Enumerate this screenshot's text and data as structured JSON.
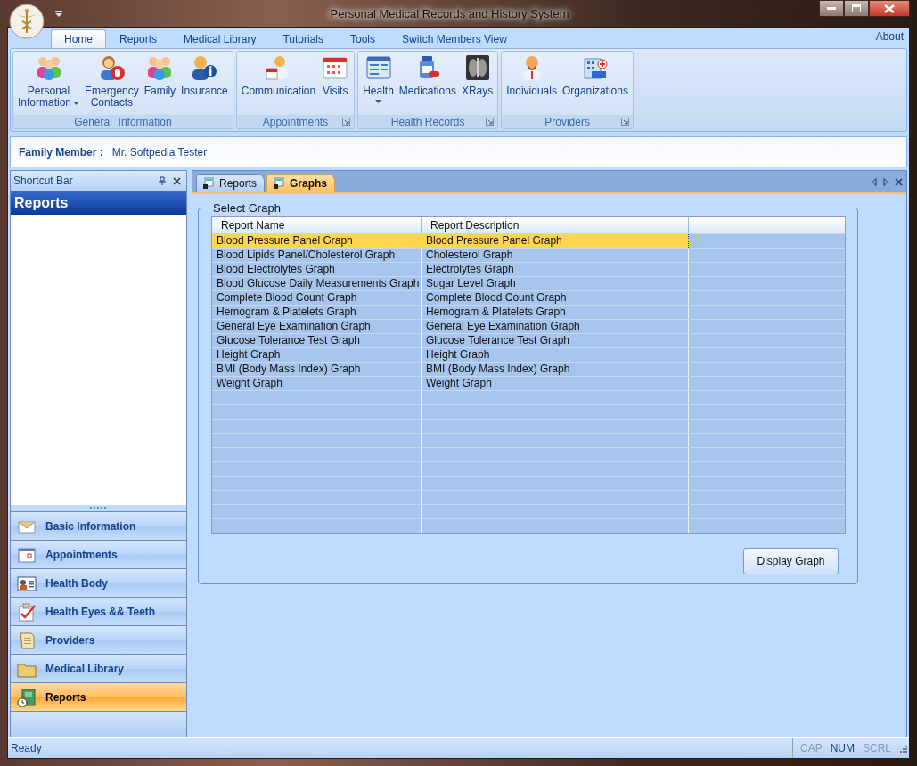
{
  "window": {
    "title": "Personal Medical Records and History System"
  },
  "ribbon": {
    "tabs": [
      {
        "label": "Home",
        "selected": true
      },
      {
        "label": "Reports",
        "selected": false
      },
      {
        "label": "Medical Library",
        "selected": false
      },
      {
        "label": "Tutorials",
        "selected": false
      },
      {
        "label": "Tools",
        "selected": false
      },
      {
        "label": "Switch Members View",
        "selected": false
      }
    ],
    "about": "About",
    "groups": [
      {
        "title": "General  Information",
        "launcher": false,
        "buttons": [
          {
            "lines": [
              "Personal",
              "Information"
            ],
            "dropdown": true
          },
          {
            "lines": [
              "Emergency",
              "Contacts"
            ],
            "dropdown": false
          },
          {
            "lines": [
              "Family"
            ],
            "dropdown": false
          },
          {
            "lines": [
              "Insurance"
            ],
            "dropdown": false
          }
        ]
      },
      {
        "title": "Appointments",
        "launcher": true,
        "buttons": [
          {
            "lines": [
              "Communication"
            ],
            "dropdown": false
          },
          {
            "lines": [
              "Visits"
            ],
            "dropdown": false
          }
        ]
      },
      {
        "title": "Health Records",
        "launcher": true,
        "buttons": [
          {
            "lines": [
              "Health"
            ],
            "dropdown": true
          },
          {
            "lines": [
              "Medications"
            ],
            "dropdown": false
          },
          {
            "lines": [
              "XRays"
            ],
            "dropdown": false
          }
        ]
      },
      {
        "title": "Providers",
        "launcher": true,
        "buttons": [
          {
            "lines": [
              "Individuals"
            ],
            "dropdown": false
          },
          {
            "lines": [
              "Organizations"
            ],
            "dropdown": false
          }
        ]
      }
    ]
  },
  "family_member": {
    "label": "Family Member :",
    "value": "Mr. Softpedia Tester"
  },
  "shortcut_bar": {
    "title": "Shortcut Bar",
    "header": "Reports",
    "items": [
      {
        "label": "Basic Information",
        "selected": false
      },
      {
        "label": "Appointments",
        "selected": false
      },
      {
        "label": "Health Body",
        "selected": false
      },
      {
        "label": "Health Eyes && Teeth",
        "selected": false
      },
      {
        "label": "Providers",
        "selected": false
      },
      {
        "label": "Medical Library",
        "selected": false
      },
      {
        "label": "Reports",
        "selected": true
      }
    ]
  },
  "doc_tabs": [
    {
      "label": "Reports",
      "selected": false
    },
    {
      "label": "Graphs",
      "selected": true
    }
  ],
  "select_graph": {
    "title": "Select Graph",
    "table": {
      "columns": [
        "Report Name",
        "Report Description"
      ],
      "rows": [
        {
          "cells": [
            "Blood Pressure Panel Graph",
            "Blood Pressure Panel Graph"
          ],
          "selected": true
        },
        {
          "cells": [
            "Blood Lipids Panel/Cholesterol Graph",
            "Cholesterol Graph"
          ],
          "selected": false
        },
        {
          "cells": [
            "Blood Electrolytes Graph",
            "Electrolytes Graph"
          ],
          "selected": false
        },
        {
          "cells": [
            "Blood Glucose Daily Measurements Graph",
            "Sugar Level Graph"
          ],
          "selected": false
        },
        {
          "cells": [
            "Complete Blood Count Graph",
            "Complete Blood Count Graph"
          ],
          "selected": false
        },
        {
          "cells": [
            "Hemogram & Platelets Graph",
            "Hemogram & Platelets Graph"
          ],
          "selected": false
        },
        {
          "cells": [
            "General Eye Examination Graph",
            "General Eye Examination Graph"
          ],
          "selected": false
        },
        {
          "cells": [
            "Glucose Tolerance Test Graph",
            "Glucose Tolerance Test Graph"
          ],
          "selected": false
        },
        {
          "cells": [
            "Height Graph",
            "Height Graph"
          ],
          "selected": false
        },
        {
          "cells": [
            "BMI (Body Mass Index) Graph",
            "BMI (Body Mass Index) Graph"
          ],
          "selected": false
        },
        {
          "cells": [
            "Weight Graph",
            "Weight Graph"
          ],
          "selected": false
        }
      ]
    },
    "button": "Display Graph"
  },
  "status_bar": {
    "text": "Ready",
    "indicators": [
      {
        "label": "CAP",
        "on": false
      },
      {
        "label": "NUM",
        "on": true
      },
      {
        "label": "SCRL",
        "on": false
      }
    ]
  }
}
